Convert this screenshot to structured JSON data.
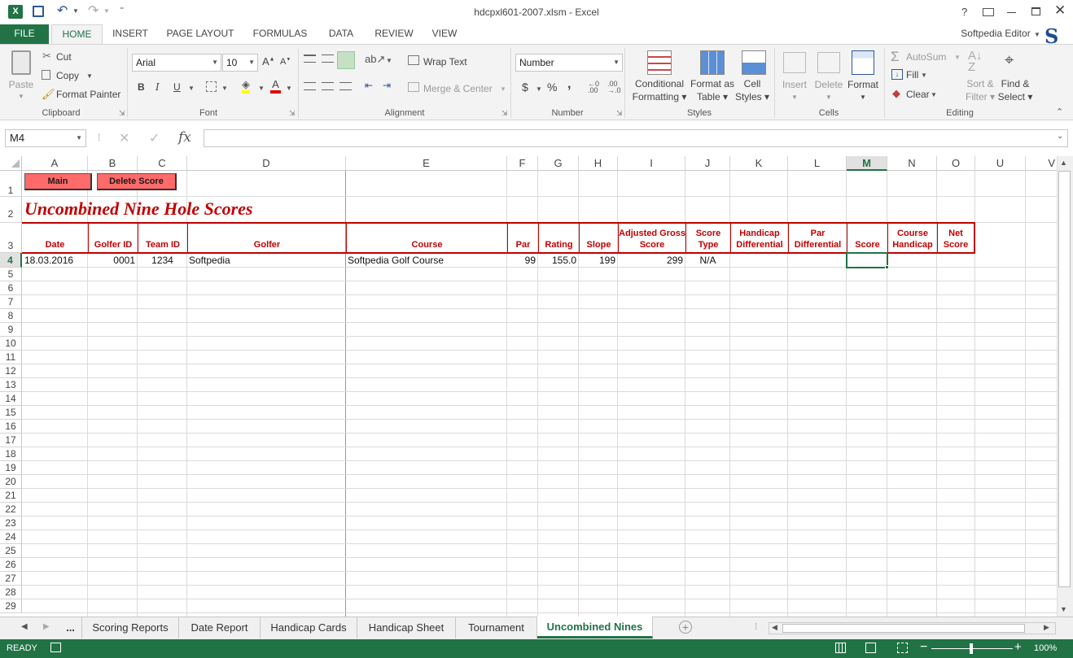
{
  "window": {
    "title": "hdcpxl601-2007.xlsm - Excel",
    "help": "?",
    "user": "Softpedia Editor"
  },
  "tabs": [
    "FILE",
    "HOME",
    "INSERT",
    "PAGE LAYOUT",
    "FORMULAS",
    "DATA",
    "REVIEW",
    "VIEW"
  ],
  "clipboard": {
    "paste": "Paste",
    "cut": "Cut",
    "copy": "Copy",
    "format_painter": "Format Painter",
    "label": "Clipboard"
  },
  "font": {
    "name": "Arial",
    "size": "10",
    "bold": "B",
    "italic": "I",
    "underline": "U",
    "label": "Font"
  },
  "alignment": {
    "wrap": "Wrap Text",
    "merge": "Merge & Center",
    "label": "Alignment"
  },
  "number": {
    "format": "Number",
    "currency": "$",
    "percent": "%",
    "comma": ",",
    "label": "Number"
  },
  "styles": {
    "conditional1": "Conditional",
    "conditional2": "Formatting",
    "table1": "Format as",
    "table2": "Table",
    "cell1": "Cell",
    "cell2": "Styles",
    "label": "Styles"
  },
  "cells": {
    "insert": "Insert",
    "delete": "Delete",
    "format": "Format",
    "label": "Cells"
  },
  "editing": {
    "autosum": "AutoSum",
    "fill": "Fill",
    "clear": "Clear",
    "sort1": "Sort &",
    "sort2": "Filter",
    "find1": "Find &",
    "find2": "Select",
    "label": "Editing"
  },
  "formula_bar": {
    "name_box": "M4",
    "fx": "fx",
    "value": ""
  },
  "columns": [
    "A",
    "B",
    "C",
    "D",
    "E",
    "F",
    "G",
    "H",
    "I",
    "J",
    "K",
    "L",
    "M",
    "N",
    "O",
    "U",
    "V"
  ],
  "rows": [
    "1",
    "2",
    "3",
    "4",
    "5",
    "6",
    "7",
    "8",
    "9",
    "10",
    "11",
    "12",
    "13",
    "14",
    "15",
    "16",
    "17",
    "18",
    "19",
    "20",
    "21",
    "22",
    "23",
    "24",
    "25",
    "26",
    "27",
    "28",
    "29"
  ],
  "sheet": {
    "btn_main": "Main",
    "btn_delete": "Delete Score",
    "title": "Uncombined Nine Hole Scores",
    "headers": [
      "Date",
      "Golfer ID",
      "Team ID",
      "Golfer",
      "Course",
      "Par",
      "Rating",
      "Slope",
      "Adjusted Gross Score",
      "Score Type",
      "Handicap Differential",
      "Par Differential",
      "Score",
      "Course Handicap",
      "Net Score"
    ],
    "row4": [
      "18.03.2016",
      "0001",
      "1234",
      "Softpedia",
      "Softpedia Golf Course",
      "99",
      "155.0",
      "199",
      "299",
      "N/A"
    ]
  },
  "sheet_tabs": [
    "...",
    "Scoring Reports",
    "Date Report",
    "Handicap Cards",
    "Handicap Sheet",
    "Tournament",
    "Uncombined Nines"
  ],
  "status": {
    "ready": "READY",
    "zoom": "100%"
  },
  "colors": {
    "excel_green": "#217346",
    "header_red": "#c00000",
    "button_red": "#ff6666"
  }
}
